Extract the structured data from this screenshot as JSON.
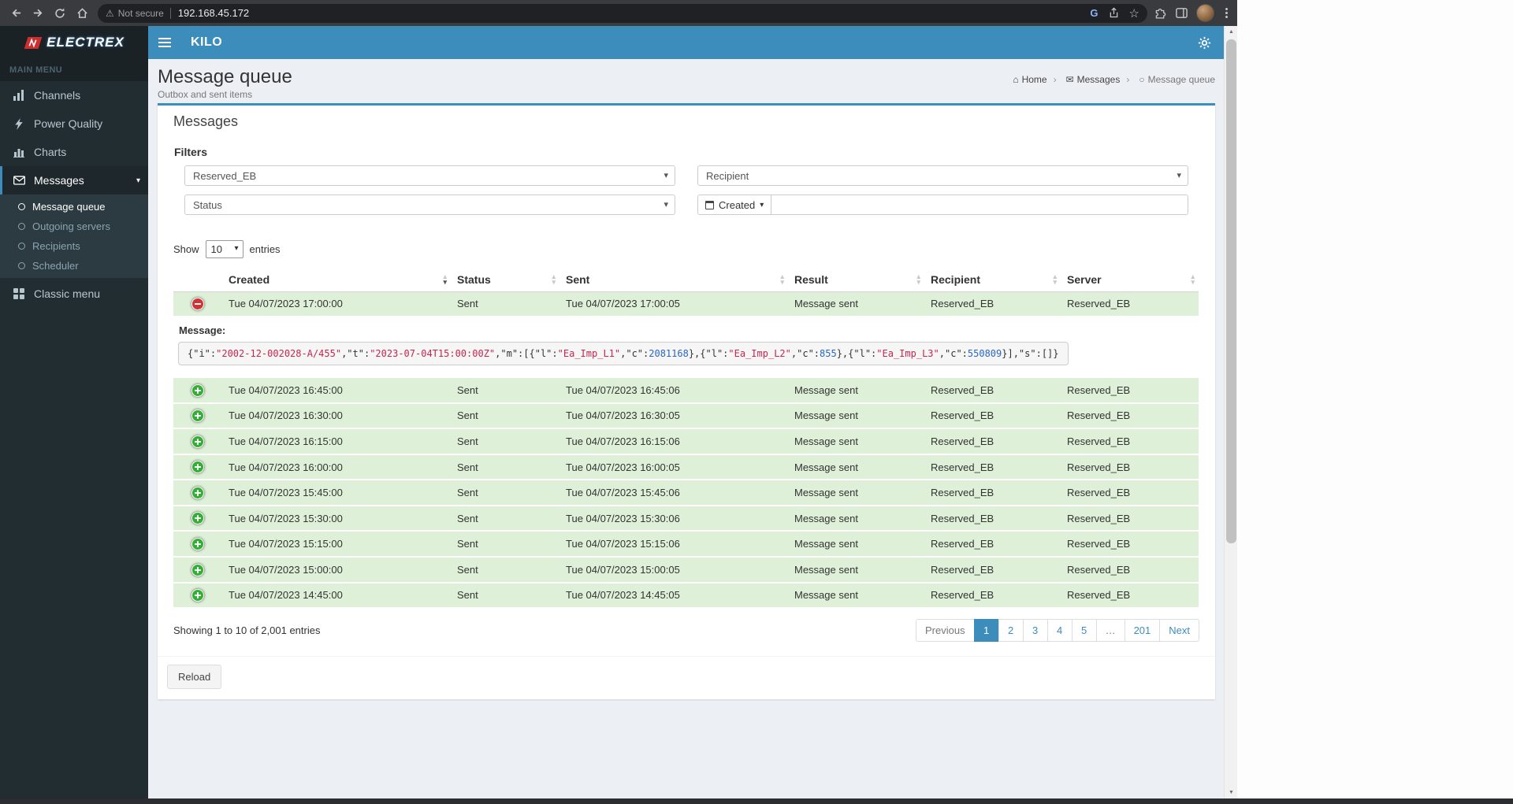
{
  "browser": {
    "security_label": "Not secure",
    "url": "192.168.45.172"
  },
  "navbar": {
    "logo_text": "ELECTREX",
    "app_title": "KILO"
  },
  "sidebar": {
    "section_label": "MAIN MENU",
    "items": [
      {
        "label": "Channels",
        "icon": "signal-icon"
      },
      {
        "label": "Power Quality",
        "icon": "bolt-icon"
      },
      {
        "label": "Charts",
        "icon": "bar-chart-icon"
      },
      {
        "label": "Messages",
        "icon": "envelope-icon",
        "active": true,
        "expanded": true,
        "children": [
          {
            "label": "Message queue",
            "active": true
          },
          {
            "label": "Outgoing servers"
          },
          {
            "label": "Recipients"
          },
          {
            "label": "Scheduler"
          }
        ]
      },
      {
        "label": "Classic menu",
        "icon": "grid-icon"
      }
    ]
  },
  "content_header": {
    "title": "Message queue",
    "subtitle": "Outbox and sent items",
    "breadcrumb": [
      "Home",
      "Messages",
      "Message queue"
    ]
  },
  "box": {
    "title": "Messages",
    "filters": {
      "label": "Filters",
      "channel_value": "Reserved_EB",
      "recipient_value": "Recipient",
      "status_value": "Status",
      "created_button": "Created",
      "created_input_value": ""
    },
    "length_menu": {
      "show": "Show",
      "value": "10",
      "entries": "entries"
    },
    "table": {
      "columns": [
        "Created",
        "Status",
        "Sent",
        "Result",
        "Recipient",
        "Server"
      ],
      "rows": [
        {
          "created": "Tue 04/07/2023 17:00:00",
          "status": "Sent",
          "sent": "Tue 04/07/2023 17:00:05",
          "result": "Message sent",
          "recipient": "Reserved_EB",
          "server": "Reserved_EB",
          "expanded": true
        },
        {
          "created": "Tue 04/07/2023 16:45:00",
          "status": "Sent",
          "sent": "Tue 04/07/2023 16:45:06",
          "result": "Message sent",
          "recipient": "Reserved_EB",
          "server": "Reserved_EB"
        },
        {
          "created": "Tue 04/07/2023 16:30:00",
          "status": "Sent",
          "sent": "Tue 04/07/2023 16:30:05",
          "result": "Message sent",
          "recipient": "Reserved_EB",
          "server": "Reserved_EB"
        },
        {
          "created": "Tue 04/07/2023 16:15:00",
          "status": "Sent",
          "sent": "Tue 04/07/2023 16:15:06",
          "result": "Message sent",
          "recipient": "Reserved_EB",
          "server": "Reserved_EB"
        },
        {
          "created": "Tue 04/07/2023 16:00:00",
          "status": "Sent",
          "sent": "Tue 04/07/2023 16:00:05",
          "result": "Message sent",
          "recipient": "Reserved_EB",
          "server": "Reserved_EB"
        },
        {
          "created": "Tue 04/07/2023 15:45:00",
          "status": "Sent",
          "sent": "Tue 04/07/2023 15:45:06",
          "result": "Message sent",
          "recipient": "Reserved_EB",
          "server": "Reserved_EB"
        },
        {
          "created": "Tue 04/07/2023 15:30:00",
          "status": "Sent",
          "sent": "Tue 04/07/2023 15:30:06",
          "result": "Message sent",
          "recipient": "Reserved_EB",
          "server": "Reserved_EB"
        },
        {
          "created": "Tue 04/07/2023 15:15:00",
          "status": "Sent",
          "sent": "Tue 04/07/2023 15:15:06",
          "result": "Message sent",
          "recipient": "Reserved_EB",
          "server": "Reserved_EB"
        },
        {
          "created": "Tue 04/07/2023 15:00:00",
          "status": "Sent",
          "sent": "Tue 04/07/2023 15:00:05",
          "result": "Message sent",
          "recipient": "Reserved_EB",
          "server": "Reserved_EB"
        },
        {
          "created": "Tue 04/07/2023 14:45:00",
          "status": "Sent",
          "sent": "Tue 04/07/2023 14:45:05",
          "result": "Message sent",
          "recipient": "Reserved_EB",
          "server": "Reserved_EB"
        }
      ],
      "detail": {
        "label": "Message:",
        "json_text": "{\"i\":\"2002-12-002028-A/455\",\"t\":\"2023-07-04T15:00:00Z\",\"m\":[{\"l\":\"Ea_Imp_L1\",\"c\":2081168},{\"l\":\"Ea_Imp_L2\",\"c\":855},{\"l\":\"Ea_Imp_L3\",\"c\":550809}],\"s\":[]}",
        "tokens": [
          {
            "t": "p",
            "v": "{\"i\":"
          },
          {
            "t": "s",
            "v": "\"2002-12-002028-A/455\""
          },
          {
            "t": "p",
            "v": ",\"t\":"
          },
          {
            "t": "s",
            "v": "\"2023-07-04T15:00:00Z\""
          },
          {
            "t": "p",
            "v": ",\"m\":[{\"l\":"
          },
          {
            "t": "s",
            "v": "\"Ea_Imp_L1\""
          },
          {
            "t": "p",
            "v": ",\"c\":"
          },
          {
            "t": "n",
            "v": "2081168"
          },
          {
            "t": "p",
            "v": "},{\"l\":"
          },
          {
            "t": "s",
            "v": "\"Ea_Imp_L2\""
          },
          {
            "t": "p",
            "v": ",\"c\":"
          },
          {
            "t": "n",
            "v": "855"
          },
          {
            "t": "p",
            "v": "},{\"l\":"
          },
          {
            "t": "s",
            "v": "\"Ea_Imp_L3\""
          },
          {
            "t": "p",
            "v": ",\"c\":"
          },
          {
            "t": "n",
            "v": "550809"
          },
          {
            "t": "p",
            "v": "}],\"s\":[]}"
          }
        ]
      }
    },
    "info": "Showing 1 to 10 of 2,001 entries",
    "pagination": {
      "items": [
        {
          "label": "Previous",
          "name": "previous",
          "disabled": true
        },
        {
          "label": "1",
          "name": "page-1",
          "active": true
        },
        {
          "label": "2",
          "name": "page-2"
        },
        {
          "label": "3",
          "name": "page-3"
        },
        {
          "label": "4",
          "name": "page-4"
        },
        {
          "label": "5",
          "name": "page-5"
        },
        {
          "label": "…",
          "name": "ellipsis",
          "disabled": true
        },
        {
          "label": "201",
          "name": "page-201"
        },
        {
          "label": "Next",
          "name": "next"
        }
      ]
    },
    "reload_button": "Reload"
  },
  "colors": {
    "accent_blue": "#3c8dbc",
    "sidebar_dark": "#222d32",
    "row_green": "#dff0d8",
    "expand_green": "#31b131",
    "collapse_red": "#d33333",
    "json_string": "#c7254e",
    "json_number": "#2a66c4"
  }
}
